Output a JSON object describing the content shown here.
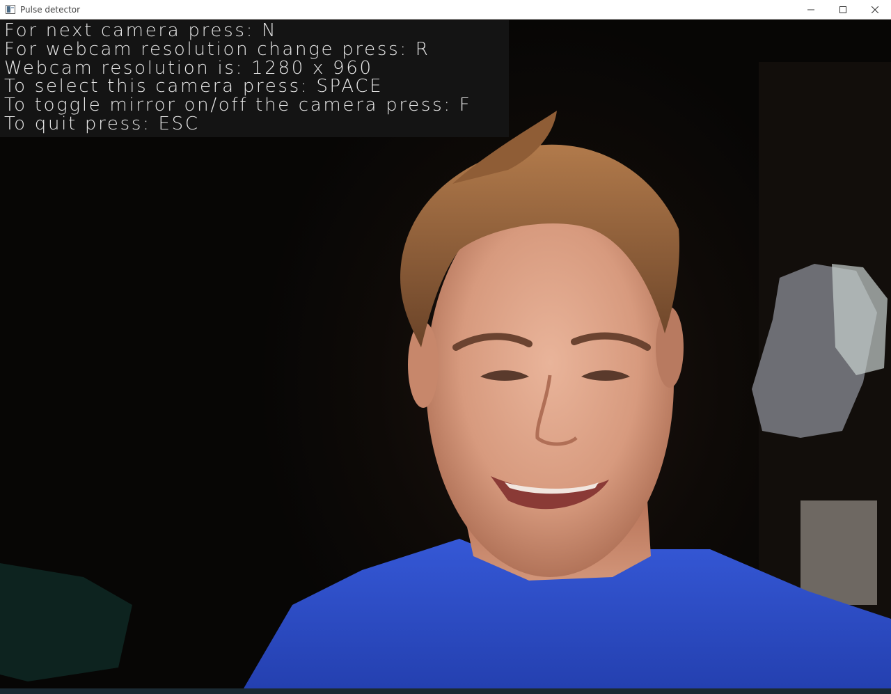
{
  "window": {
    "title": "Pulse detector",
    "controls": {
      "minimize_icon": "minimize-icon",
      "maximize_icon": "maximize-icon",
      "close_icon": "close-icon"
    }
  },
  "camera_view": {
    "feed_description_icon": "webcam-feed",
    "overlay_lines": [
      "For next camera press: N",
      "For webcam resolution change press: R",
      "Webcam resolution is: 1280 x 960",
      "To select this camera press: SPACE",
      "To toggle mirror on/off the camera press: F",
      "To quit press: ESC"
    ]
  },
  "colors": {
    "titlebar_bg": "#ffffff",
    "overlay_bg": "#141414",
    "overlay_text": "#e8e8e8",
    "shirt_blue": "#2f4fc8"
  }
}
